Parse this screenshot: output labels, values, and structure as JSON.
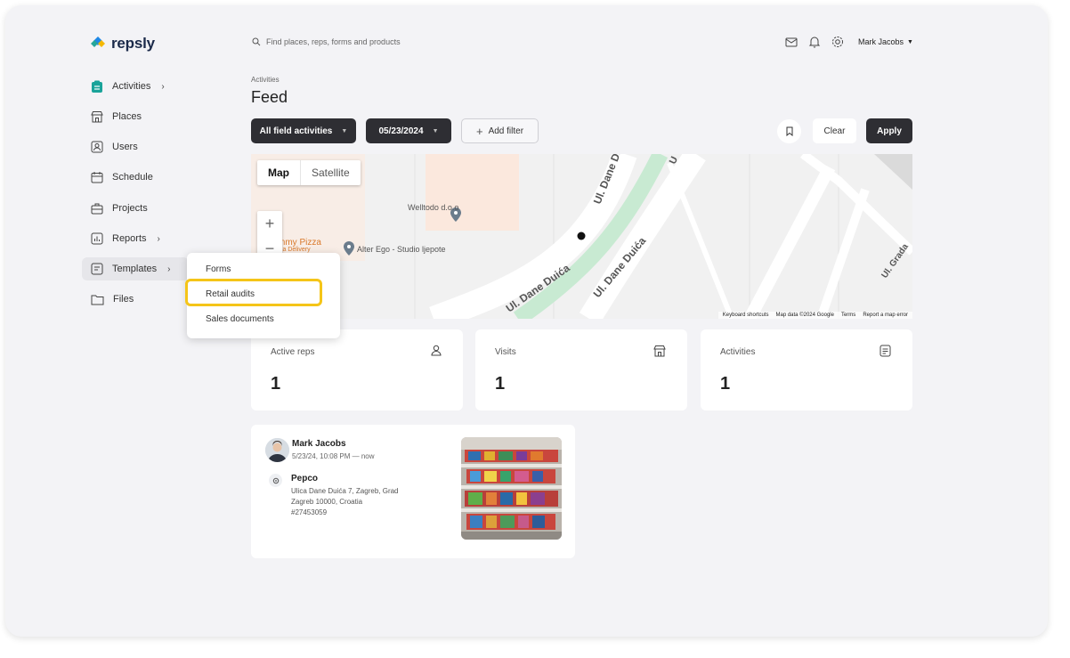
{
  "brand": {
    "name": "repsly"
  },
  "search": {
    "placeholder": "Find places, reps, forms and products"
  },
  "header": {
    "user_name": "Mark Jacobs"
  },
  "sidebar": {
    "items": [
      {
        "label": "Activities",
        "icon": "clipboard-icon",
        "chevron": "›"
      },
      {
        "label": "Places",
        "icon": "store-icon"
      },
      {
        "label": "Users",
        "icon": "user-icon"
      },
      {
        "label": "Schedule",
        "icon": "calendar-icon"
      },
      {
        "label": "Projects",
        "icon": "briefcase-icon"
      },
      {
        "label": "Reports",
        "icon": "chart-icon",
        "chevron": "›"
      },
      {
        "label": "Templates",
        "icon": "template-icon",
        "chevron": "›"
      },
      {
        "label": "Files",
        "icon": "folder-icon"
      }
    ]
  },
  "page": {
    "breadcrumb": "Activities",
    "title": "Feed"
  },
  "filters": {
    "activity_type": "All field activities",
    "date": "05/23/2024",
    "add_filter": "Add filter",
    "clear": "Clear",
    "apply": "Apply"
  },
  "map": {
    "toggle_map": "Map",
    "toggle_satellite": "Satellite",
    "zoom_in": "+",
    "zoom_out": "−",
    "places": [
      "Welltodo d.o.o",
      "Alter Ego - Studio ljepote",
      "mmy Pizza",
      "za Delivery"
    ],
    "streets": [
      "Ul. Dane Duića",
      "Ul. Dane Duića",
      "Ul. Dane Duića",
      "Ul. Dane Duića",
      "Ul. Grada",
      "U"
    ],
    "footer": [
      "Keyboard shortcuts",
      "Map data ©2024 Google",
      "Terms",
      "Report a map error"
    ]
  },
  "stats": [
    {
      "label": "Active reps",
      "value": "1",
      "icon": "user-icon"
    },
    {
      "label": "Visits",
      "value": "1",
      "icon": "store-icon"
    },
    {
      "label": "Activities",
      "value": "1",
      "icon": "clipboard-icon"
    }
  ],
  "feed": {
    "items": [
      {
        "user": "Mark Jacobs",
        "time": "5/23/24, 10:08 PM — now",
        "place": "Pepco",
        "address_line1": "Ulica Dane Duića 7, Zagreb, Grad",
        "address_line2": "Zagreb 10000, Croatia",
        "id": "#27453059"
      }
    ]
  },
  "templates_menu": {
    "items": [
      "Forms",
      "Retail audits",
      "Sales documents"
    ],
    "highlighted": "Retail audits"
  },
  "colors": {
    "accent_dark": "#2e2e33",
    "highlight": "#f5c518",
    "brand_blue": "#1e88e5",
    "brand_yellow": "#f5b800",
    "brand_teal": "#26a69a"
  }
}
